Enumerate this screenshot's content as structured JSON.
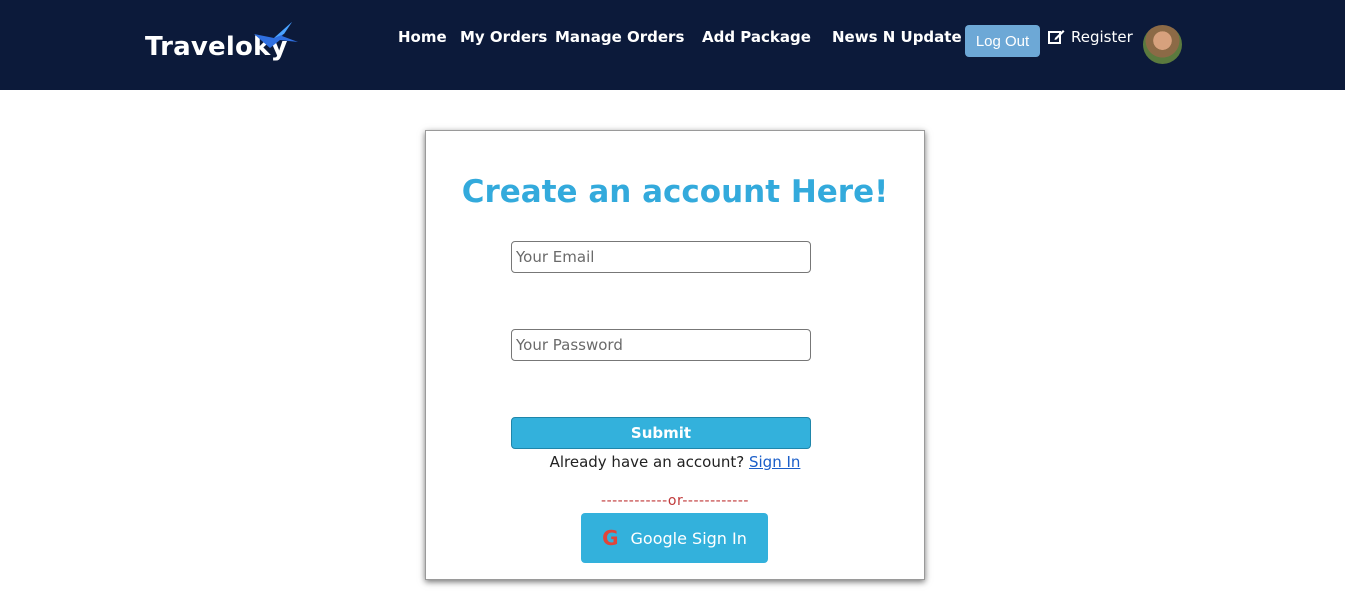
{
  "navbar": {
    "brand": "Traveloky",
    "links": [
      "Home",
      "My Orders",
      "Manage Orders",
      "Add Package",
      "News N Update"
    ],
    "logout_label": "Log Out",
    "register_label": "Register"
  },
  "form": {
    "title": "Create an account Here!",
    "email_placeholder": "Your Email",
    "password_placeholder": "Your Password",
    "submit_label": "Submit",
    "already_text": "Already have an account?",
    "signin_link": "Sign In",
    "divider": "------------or------------",
    "google_label": "Google Sign In"
  },
  "colors": {
    "navbar_bg": "#0c1a3a",
    "accent": "#33b1dc",
    "title": "#33aadc",
    "logout_bg": "#6da8d6",
    "divider": "#c0393a"
  },
  "icons": {
    "brand": "bird-logo-icon",
    "register": "edit-icon",
    "google": "google-icon",
    "avatar": "avatar"
  }
}
